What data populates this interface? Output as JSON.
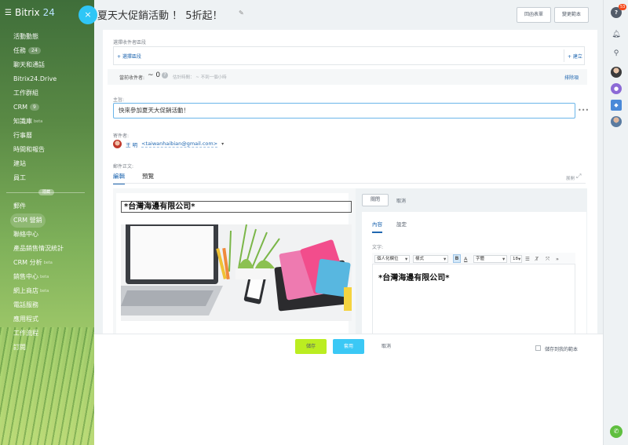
{
  "sidebar": {
    "logo": "Bitrix",
    "logo_suffix": "24",
    "close_label": "×",
    "menu_items": [
      {
        "label": "活動動態"
      },
      {
        "label": "任務",
        "badge": "24"
      },
      {
        "label": "聊天和通話"
      },
      {
        "label": "Bitrix24.Drive"
      },
      {
        "label": "工作群組"
      },
      {
        "label": "CRM",
        "badge": "9"
      },
      {
        "label": "知識庫",
        "beta": "beta"
      },
      {
        "label": "行事曆"
      },
      {
        "label": "時間和報告"
      },
      {
        "label": "建站"
      },
      {
        "label": "員工"
      }
    ],
    "separator_label": "隱藏",
    "hidden_items": [
      {
        "label": "郵件"
      },
      {
        "label": "CRM 營銷",
        "active": true
      },
      {
        "label": "聯絡中心"
      },
      {
        "label": "產品銷售情況統計"
      },
      {
        "label": "CRM 分析",
        "beta": "beta"
      },
      {
        "label": "銷售中心",
        "beta": "beta"
      },
      {
        "label": "網上商店",
        "beta": "beta"
      },
      {
        "label": "電話服務"
      },
      {
        "label": "應用程式"
      },
      {
        "label": "工作流程"
      },
      {
        "label": "訂閱"
      }
    ]
  },
  "header": {
    "title": "夏天大促銷活動 ！ 5折起！",
    "edit_icon": "pencil-icon",
    "buttons": {
      "return_form": "回函表單",
      "change_template": "變更範本"
    }
  },
  "recipients": {
    "label": "選擇收件者區段",
    "select_link": "+ 選擇區段",
    "create_link": "+ 建立",
    "current_label": "當前收件者:",
    "current_value": "~ 0",
    "estimate_text": "估計時間： ~ 不到一個小時",
    "exclude_link": "排除項"
  },
  "subject": {
    "label": "主旨:",
    "value": "快來參加夏天大促銷活動！"
  },
  "sender": {
    "label": "寄件者:",
    "name": "王 明",
    "email": "<taiwanhaibian@gmail.com>"
  },
  "body": {
    "label": "郵件正文:",
    "tabs": [
      "編輯",
      "預覽"
    ],
    "expand_label": "展開",
    "preview_heading": "*台灣海邊有限公司*"
  },
  "panel": {
    "close_button": "關閉",
    "cancel_button": "取消",
    "tabs": [
      "內容",
      "設定"
    ],
    "text_label": "文字:",
    "toolbar": {
      "personalize": "個人化欄位",
      "style": "樣式",
      "font": "字體",
      "size": "18"
    },
    "editor_text": "*台灣海邊有限公司*"
  },
  "footer": {
    "save": "儲存",
    "apply": "套用",
    "cancel": "取消",
    "save_template": "儲存到我的範本"
  },
  "rightbar": {
    "notification_count": "53"
  },
  "colors": {
    "accent": "#2fc6f6",
    "save": "#bbed21",
    "link": "#2067b0"
  }
}
